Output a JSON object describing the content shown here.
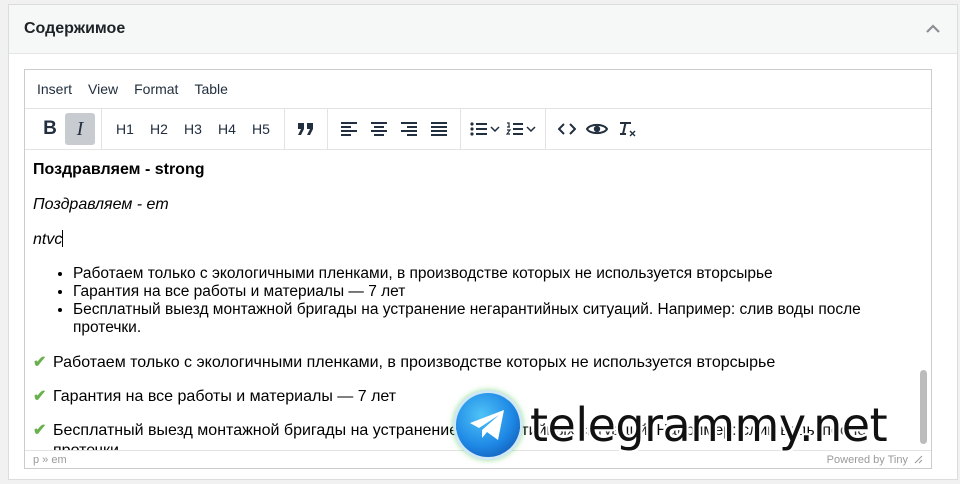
{
  "panel": {
    "title": "Содержимое"
  },
  "menubar": {
    "items": [
      "Insert",
      "View",
      "Format",
      "Table"
    ]
  },
  "toolbar": {
    "bold": "B",
    "italic": "I",
    "headings": [
      "H1",
      "H2",
      "H3",
      "H4",
      "H5"
    ]
  },
  "content": {
    "strong_line": "Поздравляем - strong",
    "em_line": "Поздравляем - em",
    "typed_line": "ntvc",
    "bullets": [
      "Работаем только с экологичными пленками, в производстве которых не используется вторсырье",
      "Гарантия на все работы и материалы — 7 лет",
      "Бесплатный выезд монтажной бригады на устранение негарантийных ситуаций. Например: слив воды после протечки."
    ],
    "checks": [
      "Работаем только с экологичными пленками, в производстве которых не используется вторсырье",
      "Гарантия на все работы и материалы — 7 лет",
      "Бесплатный выезд монтажной бригады на устранение негарантийных ситуаций. Например: слив воды после протечки."
    ]
  },
  "statusbar": {
    "path": "p » em",
    "branding": "Powered by Tiny"
  },
  "watermark": {
    "text": "telegrammy.net"
  },
  "colors": {
    "accent_check": "#6ab04c",
    "active_button": "#c8cbcf"
  }
}
